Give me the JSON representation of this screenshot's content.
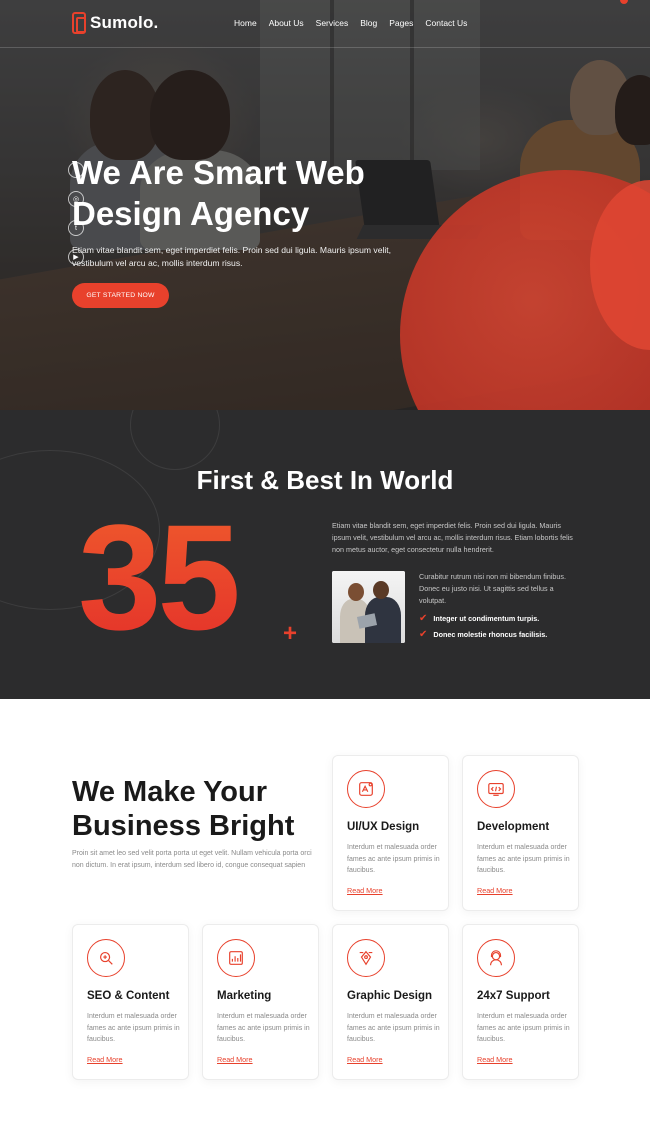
{
  "header": {
    "logo_text": "Sumolo.",
    "nav": [
      "Home",
      "About Us",
      "Services",
      "Blog",
      "Pages",
      "Contact Us"
    ]
  },
  "hero": {
    "title": "We Are Smart Web Design Agency",
    "text": "Etiam vitae blandit sem, eget imperdiet felis. Proin sed dui ligula. Mauris ipsum velit, vestibulum vel arcu ac, mollis interdum risus.",
    "button": "GET STARTED NOW",
    "social_icons": [
      "facebook-icon",
      "instagram-icon",
      "twitter-icon",
      "youtube-icon"
    ]
  },
  "stats": {
    "title": "First & Best In World",
    "number": "35",
    "plus": "+",
    "paragraph": "Etiam vitae blandit sem, eget imperdiet felis. Proin sed dui ligula. Mauris ipsum velit, vestibulum vel arcu ac, mollis interdum risus. Etiam lobortis felis non metus auctor, eget consectetur nulla hendrerit.",
    "sub_paragraph": "Curabitur rutrum nisi non mi bibendum finibus. Donec eu justo nisi. Ut sagittis sed tellus a volutpat.",
    "checks": [
      "Integer ut condimentum turpis.",
      "Donec molestie rhoncus facilisis."
    ]
  },
  "services": {
    "title": "We Make Your Business Bright",
    "paragraph": "Proin sit amet leo sed velit porta porta ut eget velit. Nullam vehicula porta orci non dictum. In erat ipsum, interdum sed libero id, congue consequat sapien",
    "cards": [
      {
        "title": "UI/UX Design",
        "text": "Interdum et malesuada order fames ac ante ipsum primis in faucibus.",
        "link": "Read More",
        "icon": "design-icon"
      },
      {
        "title": "Development",
        "text": "Interdum et malesuada order fames ac ante ipsum primis in faucibus.",
        "link": "Read More",
        "icon": "development-icon"
      },
      {
        "title": "SEO & Content",
        "text": "Interdum et malesuada order fames ac ante ipsum primis in faucibus.",
        "link": "Read More",
        "icon": "seo-icon"
      },
      {
        "title": "Marketing",
        "text": "Interdum et malesuada order fames ac ante ipsum primis in faucibus.",
        "link": "Read More",
        "icon": "marketing-icon"
      },
      {
        "title": "Graphic Design",
        "text": "Interdum et malesuada order fames ac ante ipsum primis in faucibus.",
        "link": "Read More",
        "icon": "graphic-design-icon"
      },
      {
        "title": "24x7 Support",
        "text": "Interdum et malesuada order fames ac ante ipsum primis in faucibus.",
        "link": "Read More",
        "icon": "support-icon"
      }
    ]
  },
  "colors": {
    "accent": "#e8412c",
    "dark_bg": "#2c2c2d"
  }
}
